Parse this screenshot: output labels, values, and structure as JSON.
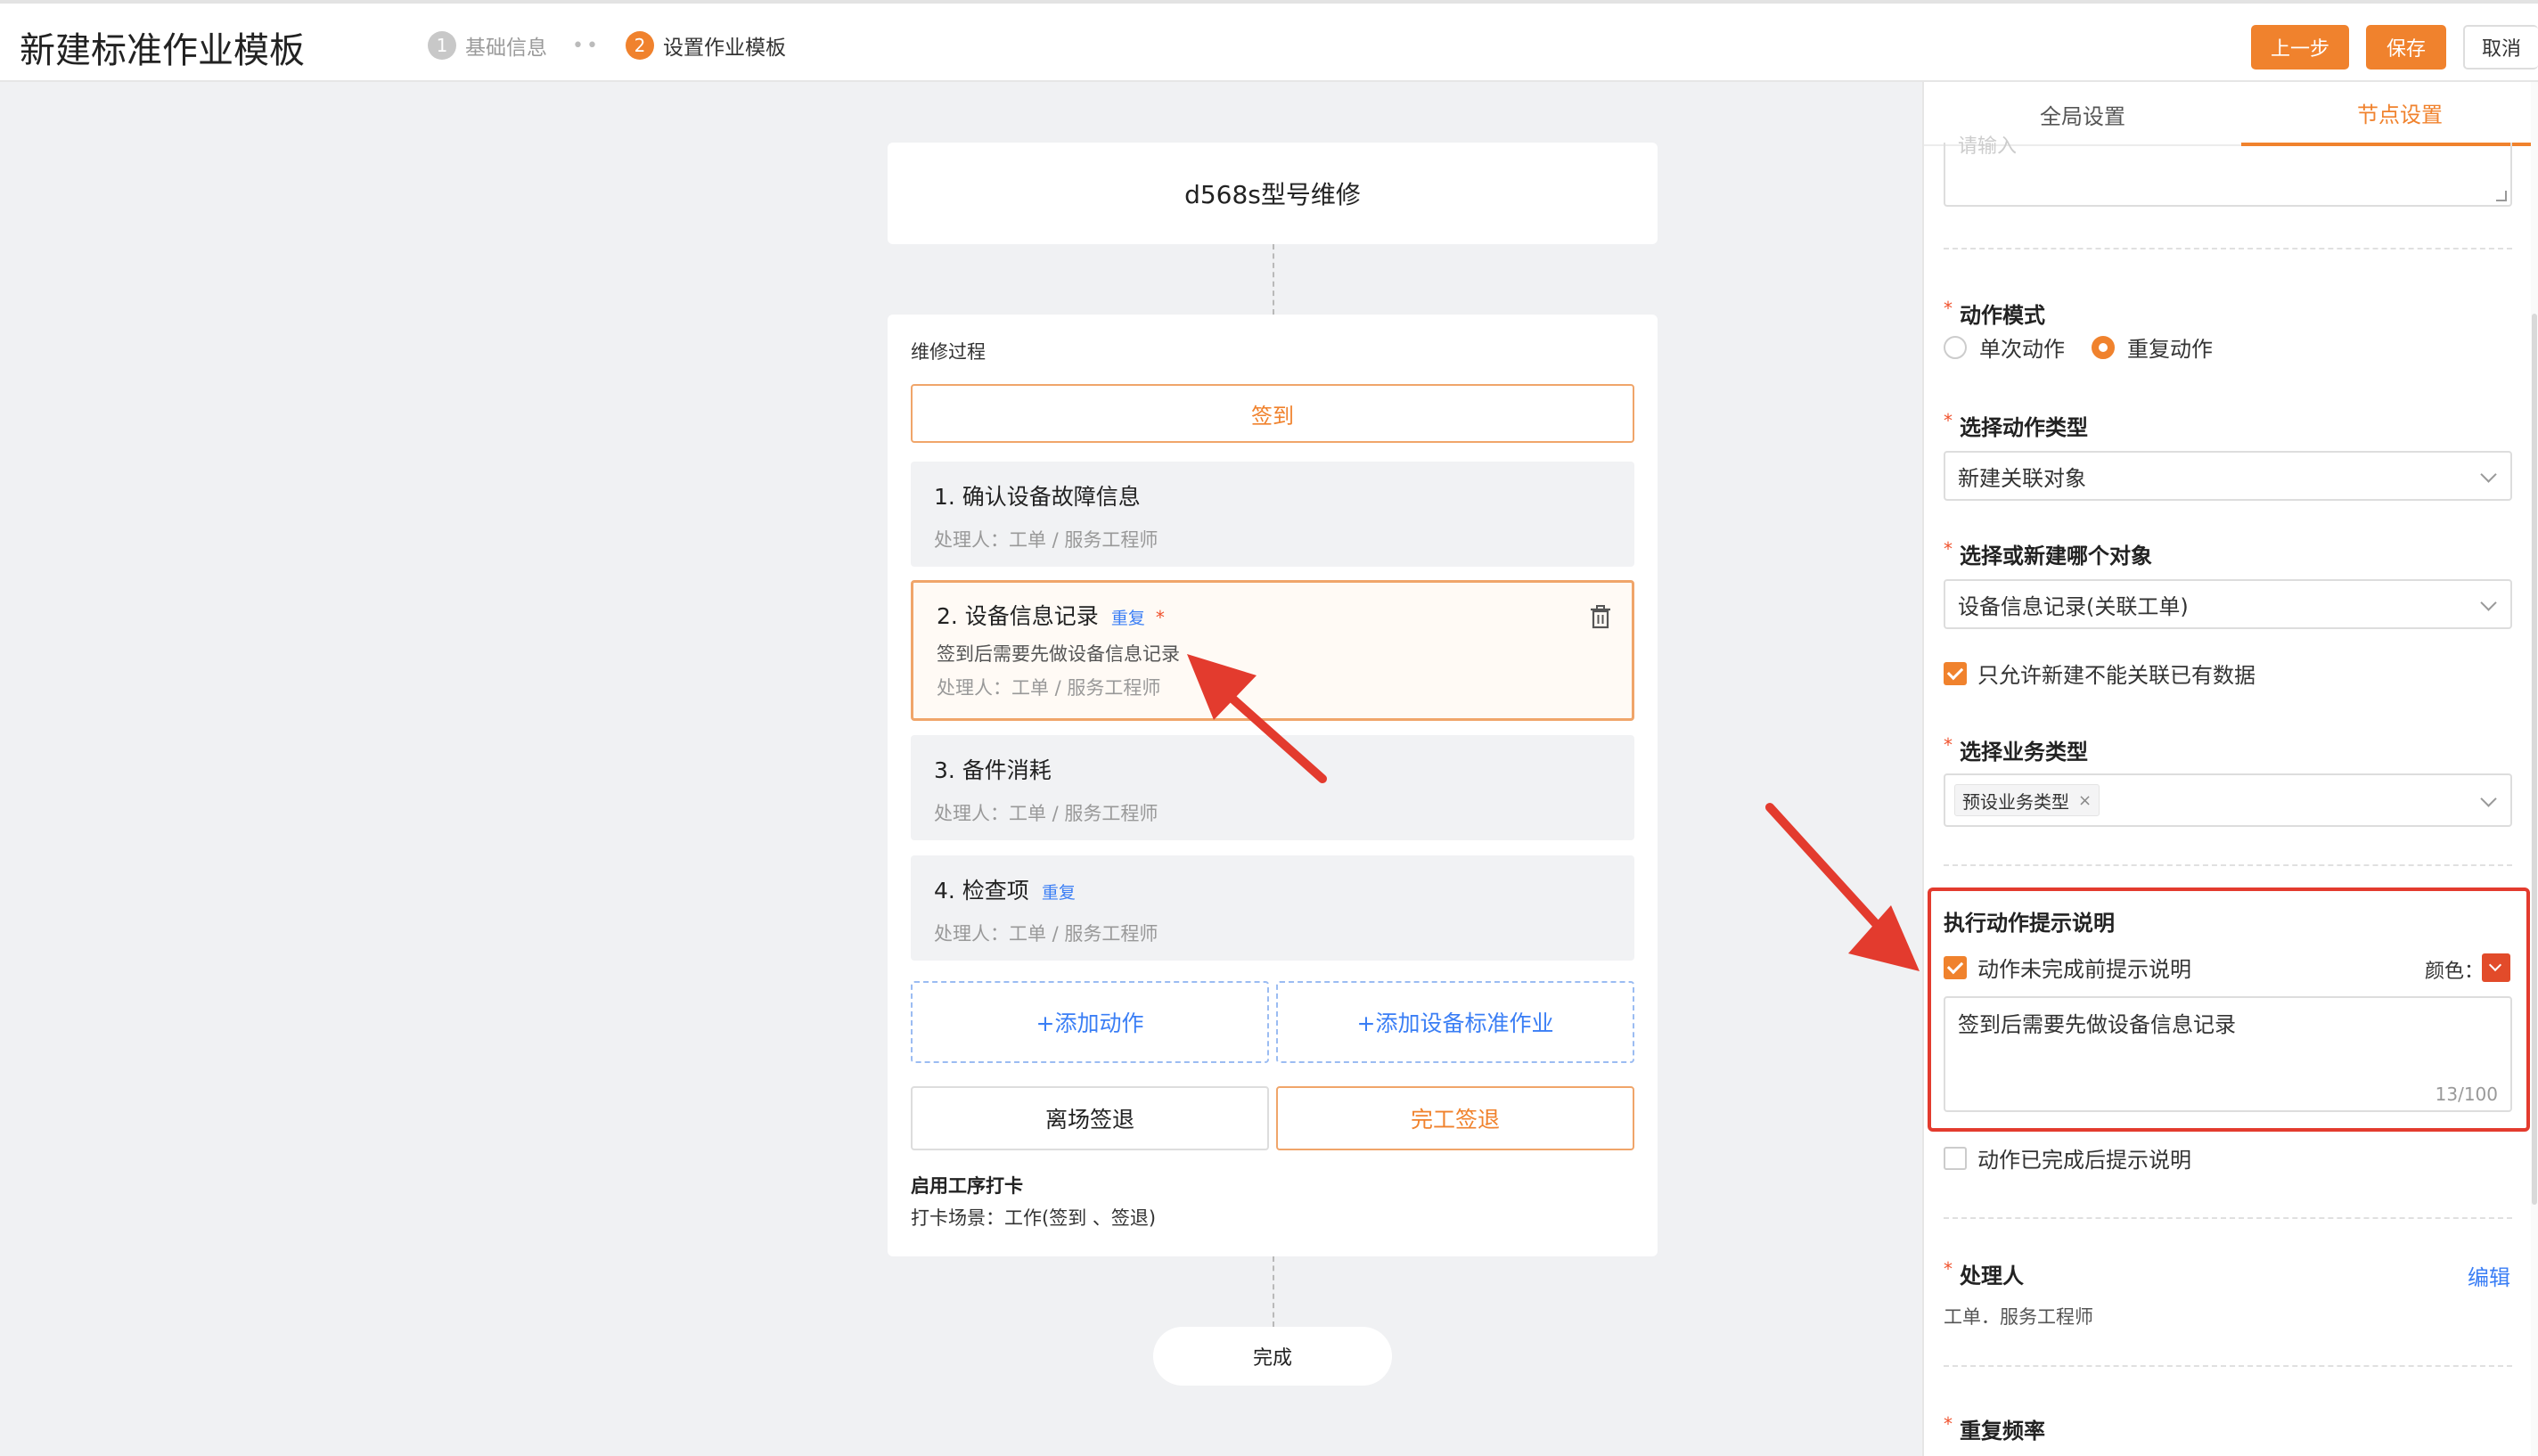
{
  "header": {
    "title": "新建标准作业模板",
    "steps": [
      {
        "num": "1",
        "label": "基础信息"
      },
      {
        "num": "2",
        "label": "设置作业模板"
      }
    ],
    "step_separator": "••",
    "buttons": {
      "prev": "上一步",
      "save": "保存",
      "cancel": "取消"
    }
  },
  "flow": {
    "template_name": "d568s型号维修",
    "section_label": "维修过程",
    "signin": "签到",
    "handler_prefix": "处理人：",
    "steps": [
      {
        "title": "1. 确认设备故障信息",
        "handler": "处理人：工单 / 服务工程师"
      },
      {
        "title": "2. 设备信息记录",
        "repeat": "重复",
        "required": "*",
        "hint": "签到后需要先做设备信息记录",
        "handler": "处理人：工单 / 服务工程师"
      },
      {
        "title": "3. 备件消耗",
        "handler": "处理人：工单 / 服务工程师"
      },
      {
        "title": "4. 检查项",
        "repeat": "重复",
        "handler": "处理人：工单 / 服务工程师"
      }
    ],
    "add_action": "+添加动作",
    "add_standard": "+添加设备标准作业",
    "leave_signout": "离场签退",
    "finish_signout": "完工签退",
    "clock_title": "启用工序打卡",
    "clock_scene": "打卡场景：工作(签到 、签退)",
    "done": "完成"
  },
  "panel": {
    "tabs": {
      "global": "全局设置",
      "node": "节点设置"
    },
    "top_placeholder": "请输入",
    "action_mode": {
      "label": "动作模式",
      "options": [
        "单次动作",
        "重复动作"
      ],
      "selected": "重复动作"
    },
    "action_type": {
      "label": "选择动作类型",
      "value": "新建关联对象"
    },
    "object": {
      "label": "选择或新建哪个对象",
      "value": "设备信息记录(关联工单)"
    },
    "only_new": {
      "label": "只允许新建不能关联已有数据",
      "checked": true
    },
    "business_type": {
      "label": "选择业务类型",
      "tag": "预设业务类型",
      "tag_close": "×"
    },
    "execution_hint": {
      "title": "执行动作提示说明",
      "before_label": "动作未完成前提示说明",
      "before_checked": true,
      "color_label": "颜色：",
      "color": "#e24b2a",
      "text": "签到后需要先做设备信息记录",
      "counter": "13/100",
      "after_label": "动作已完成后提示说明",
      "after_checked": false
    },
    "handler": {
      "label": "处理人",
      "edit": "编辑",
      "value": "工单．服务工程师"
    },
    "repeat_freq": {
      "label": "重复频率"
    }
  },
  "colors": {
    "accent": "#f0822d",
    "link": "#3a7ef5",
    "highlight": "#e33b2e"
  }
}
